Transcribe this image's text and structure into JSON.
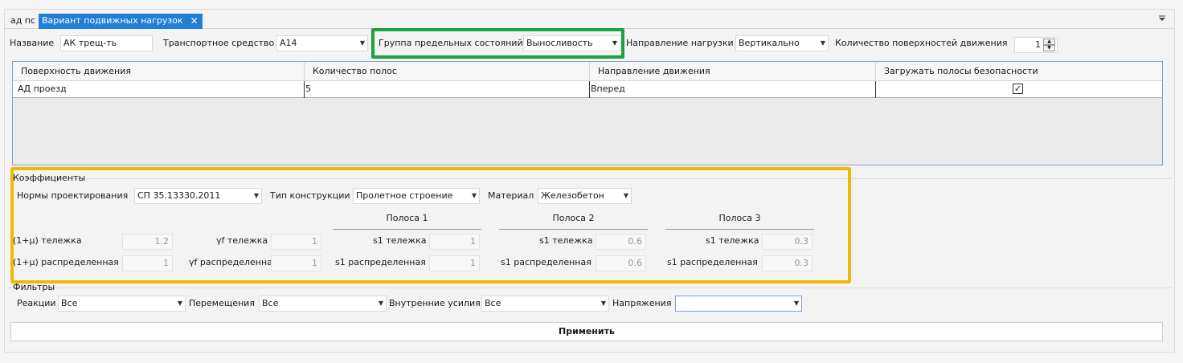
{
  "tabs": [
    {
      "label": "ад пс",
      "active": false
    },
    {
      "label": "Вариант подвижных нагрузок",
      "active": true
    }
  ],
  "close_glyph": "✕",
  "top_row": {
    "name_label": "Название",
    "name_value": "АК трещ-ть",
    "vehicle_label": "Транспортное средство",
    "vehicle_value": "А14",
    "limit_group_label": "Группа предельных состояний",
    "limit_group_value": "Выносливость",
    "direction_label": "Направление нагрузки",
    "direction_value": "Вертикально",
    "surfaces_count_label": "Количество поверхностей движения",
    "surfaces_count_value": "1"
  },
  "grid": {
    "columns": [
      "Поверхность движения",
      "Количество полос",
      "Направление движения",
      "Загружать полосы безопасности"
    ],
    "rows": [
      {
        "surface": "АД проезд",
        "lanes": "5",
        "direction": "Вперед",
        "safety_lanes": true
      }
    ]
  },
  "coefficients": {
    "title": "Коэффициенты",
    "norms_label": "Нормы проектирования",
    "norms_value": "СП 35.13330.2011",
    "construction_label": "Тип конструкции",
    "construction_value": "Пролетное строение",
    "material_label": "Материал",
    "material_value": "Железобетон",
    "mu_trolley_label": "(1+μ) тележка",
    "mu_trolley_value": "1.2",
    "mu_distributed_label": "(1+μ) распределенная",
    "mu_distributed_value": "1",
    "yf_trolley_label": "γf тележка",
    "yf_trolley_value": "1",
    "yf_distributed_label": "γf распределенная",
    "yf_distributed_value": "1",
    "lanes": [
      {
        "title": "Полоса 1",
        "s1_trolley_label": "s1 тележка",
        "s1_trolley": "1",
        "s1_distributed_label": "s1 распределенная",
        "s1_distributed": "1"
      },
      {
        "title": "Полоса 2",
        "s1_trolley_label": "s1 тележка",
        "s1_trolley": "0.6",
        "s1_distributed_label": "s1 распределенная",
        "s1_distributed": "0.6"
      },
      {
        "title": "Полоса 3",
        "s1_trolley_label": "s1 тележка",
        "s1_trolley": "0.3",
        "s1_distributed_label": "s1 распределенная",
        "s1_distributed": "0.3"
      }
    ]
  },
  "filters": {
    "title": "Фильтры",
    "reactions_label": "Реакции",
    "reactions_value": "Все",
    "displacements_label": "Перемещения",
    "displacements_value": "Все",
    "forces_label": "Внутренние усилия",
    "forces_value": "Все",
    "stresses_label": "Напряжения",
    "stresses_value": ""
  },
  "apply_label": "Применить",
  "colors": {
    "tab_active": "#1f7fd3",
    "highlight_green": "#1aa23c",
    "highlight_yellow": "#f2b705"
  },
  "icons": [
    "close-icon",
    "panel-menu-icon",
    "dropdown-arrow-icon",
    "checkbox-checked-icon",
    "spin-up-icon",
    "spin-down-icon"
  ]
}
